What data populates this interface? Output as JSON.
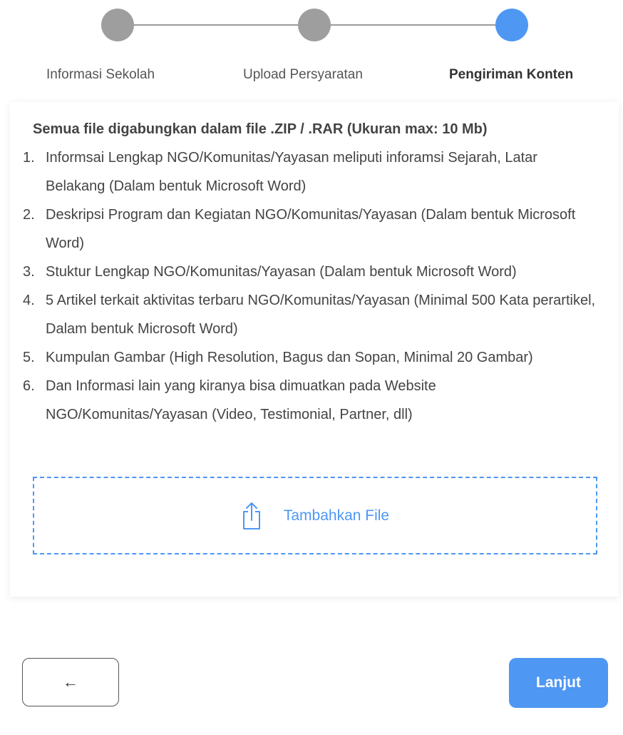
{
  "stepper": {
    "steps": [
      {
        "label": "Informasi Sekolah",
        "state": "done"
      },
      {
        "label": "Upload Persyaratan",
        "state": "done"
      },
      {
        "label": "Pengiriman Konten",
        "state": "active"
      }
    ],
    "colors": {
      "done": "#9e9e9e",
      "active": "#4e97f3"
    }
  },
  "content": {
    "title": "Semua file digabungkan dalam file .ZIP / .RAR (Ukuran max: 10 Mb)",
    "requirements": [
      {
        "num": "1.",
        "text": "Informsai Lengkap NGO/Komunitas/Yayasan meliputi inforamsi Sejarah, Latar Belakang (Dalam bentuk Microsoft Word)"
      },
      {
        "num": "2.",
        "text": "Deskripsi Program dan Kegiatan NGO/Komunitas/Yayasan (Dalam bentuk Microsoft Word)"
      },
      {
        "num": "3.",
        "text": "Stuktur Lengkap NGO/Komunitas/Yayasan (Dalam bentuk Microsoft Word)"
      },
      {
        "num": "4.",
        "text": "5 Artikel terkait aktivitas terbaru NGO/Komunitas/Yayasan (Minimal 500 Kata perartikel, Dalam bentuk Microsoft Word)"
      },
      {
        "num": "5.",
        "text": "Kumpulan Gambar (High Resolution, Bagus dan Sopan, Minimal 20 Gambar)"
      },
      {
        "num": "6.",
        "text": "Dan Informasi lain yang kiranya bisa dimuatkan pada Website NGO/Komunitas/Yayasan (Video, Testimonial, Partner, dll)"
      }
    ],
    "upload": {
      "icon": "share-upload-icon",
      "label": "Tambahkan File"
    }
  },
  "footer": {
    "back_label": "←",
    "next_label": "Lanjut"
  }
}
